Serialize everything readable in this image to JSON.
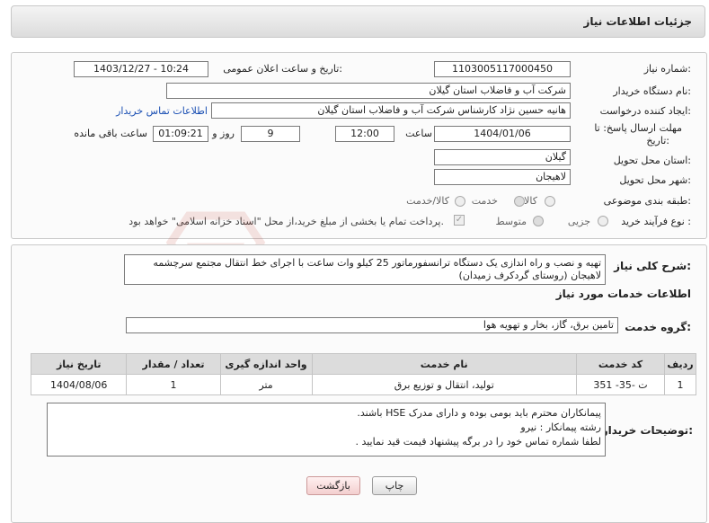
{
  "header": {
    "title": "جزئیات اطلاعات نیاز"
  },
  "form": {
    "need_number_label": "شماره نیاز:",
    "need_number": "1103005117000450",
    "announce_label": "تاریخ و ساعت اعلان عمومی:",
    "announce_value": "1403/12/27 - 10:24",
    "buyer_org_label": "نام دستگاه خریدار:",
    "buyer_org": "شرکت آب و فاضلاب استان گیلان",
    "creator_label": "ایجاد کننده درخواست:",
    "creator": "هانیه حسین نژاد کارشناس شرکت آب و فاضلاب استان گیلان",
    "contact_link": "اطلاعات تماس خریدار",
    "deadline_label_1": "مهلت ارسال پاسخ: تا",
    "deadline_label_2": "تاریخ:",
    "deadline_date": "1404/01/06",
    "time_label": "ساعت",
    "deadline_time": "12:00",
    "days_value": "9",
    "days_label": "روز و",
    "remaining_time": "01:09:21",
    "remaining_label": "ساعت باقی مانده",
    "province_label": "استان محل تحویل:",
    "province": "گیلان",
    "city_label": "شهر محل تحویل:",
    "city": "لاهیجان",
    "category_label": "طبقه بندی موضوعی:",
    "category_options": [
      "کالا",
      "خدمت",
      "کالا/خدمت"
    ],
    "category_selected": "خدمت",
    "process_label": "نوع فرآیند خرید :",
    "process_options": [
      "جزیی",
      "متوسط"
    ],
    "process_selected": "متوسط",
    "treasury_note": "پرداخت تمام یا بخشی از مبلغ خرید،از محل \"اسناد خزانه اسلامی\" خواهد بود."
  },
  "description": {
    "label": "شرح کلی نیاز:",
    "text": "تهیه و نصب و راه اندازی یک دستگاه ترانسفورماتور 25 کیلو وات ساعت با اجرای خط انتقال مجتمع سرچشمه لاهیجان (روستای گردکرف زمیدان)"
  },
  "services": {
    "section_title": "اطلاعات خدمات مورد نیاز",
    "group_label": "گروه خدمت:",
    "group_value": "تامین برق، گاز، بخار و تهویه هوا",
    "columns": [
      "ردیف",
      "کد خدمت",
      "نام خدمت",
      "واحد اندازه گیری",
      "تعداد / مقدار",
      "تاریخ نیاز"
    ],
    "rows": [
      {
        "row": "1",
        "code": "ت -35- 351",
        "name": "تولید، انتقال و توزیع برق",
        "unit": "متر",
        "qty": "1",
        "date": "1404/08/06"
      }
    ]
  },
  "buyer_notes": {
    "label": "توضیحات خریدار:",
    "lines": [
      "پیمانکاران محترم باید  بومی بوده و  دارای مدرک HSE باشند.",
      "رشته پیمانکار : نیرو",
      "لطفا شماره تماس خود را در برگه پیشنهاد قیمت قید نمایید ."
    ]
  },
  "buttons": {
    "print": "چاپ",
    "back": "بازگشت"
  },
  "watermark": {
    "text": "AriaTender.neT"
  },
  "colors": {
    "link": "#1a4fb3",
    "watermark": "#c0392b"
  }
}
